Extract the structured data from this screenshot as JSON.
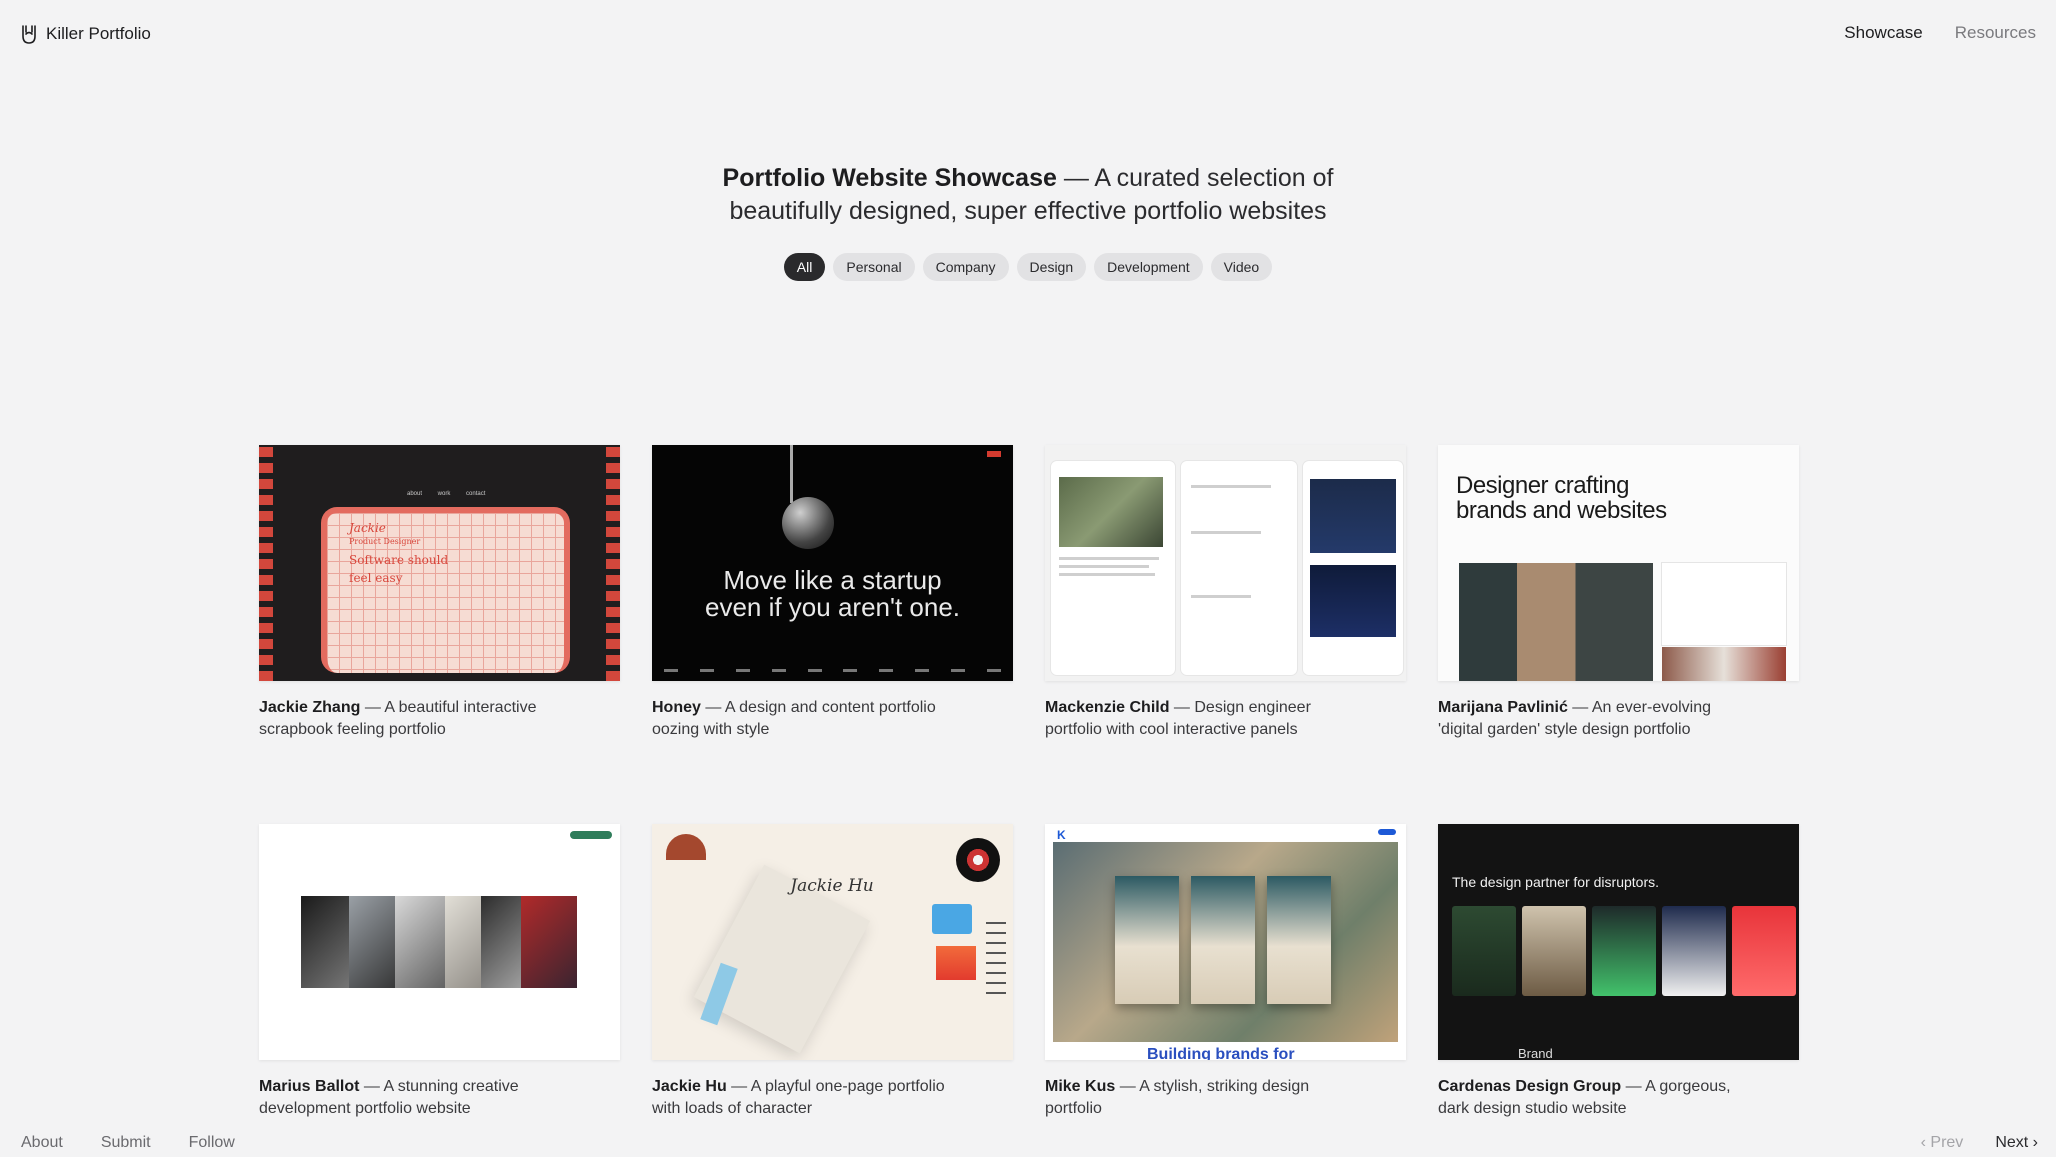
{
  "brand": {
    "name": "Killer Portfolio",
    "logo_icon": "rock-hand-icon"
  },
  "nav": {
    "showcase": "Showcase",
    "resources": "Resources"
  },
  "hero": {
    "title": "Portfolio Website Showcase",
    "subtitle_rest": " — A curated selection of",
    "subtitle_line2": "beautifully designed, super effective portfolio websites"
  },
  "filters": [
    "All",
    "Personal",
    "Company",
    "Design",
    "Development",
    "Video"
  ],
  "active_filter": "All",
  "cards": [
    {
      "name": "Jackie Zhang",
      "desc": " — A beautiful interactive scrapbook feeling portfolio",
      "thumb": {
        "nav": "about work contact",
        "line1": "Jackie",
        "line2": "Product Designer",
        "line3": "Software should",
        "line4": "feel easy"
      }
    },
    {
      "name": "Honey",
      "desc": " — A design and content portfolio oozing with style",
      "thumb": {
        "line1": "Move like a startup",
        "line2": "even if you aren't one."
      }
    },
    {
      "name": "Mackenzie Child",
      "desc": " — Design engineer portfolio with cool interactive panels",
      "thumb": {}
    },
    {
      "name": "Marijana Pavlinić",
      "desc": " — An ever-evolving 'digital garden' style design portfolio",
      "thumb": {
        "line1": "Designer crafting",
        "line2": "brands and websites"
      }
    },
    {
      "name": "Marius Ballot",
      "desc": " — A stunning creative development portfolio website",
      "thumb": {}
    },
    {
      "name": "Jackie Hu",
      "desc": " — A playful one-page portfolio with loads of character",
      "thumb": {
        "line1": "Jackie Hu"
      }
    },
    {
      "name": "Mike Kus",
      "desc": " — A stylish, striking design portfolio",
      "thumb": {
        "line1": "K",
        "line2": "Building brands for"
      }
    },
    {
      "name": "Cardenas Design Group",
      "desc": " — A gorgeous, dark design studio website",
      "thumb": {
        "line1": "The design partner for disruptors.",
        "line2": "Brand"
      }
    }
  ],
  "footer": {
    "about": "About",
    "submit": "Submit",
    "follow": "Follow"
  },
  "pager": {
    "prev": "Prev",
    "next": "Next"
  },
  "colors": {
    "background": "#f3f3f4",
    "active_chip": "#2a2a2c",
    "chip": "#e2e2e4"
  }
}
